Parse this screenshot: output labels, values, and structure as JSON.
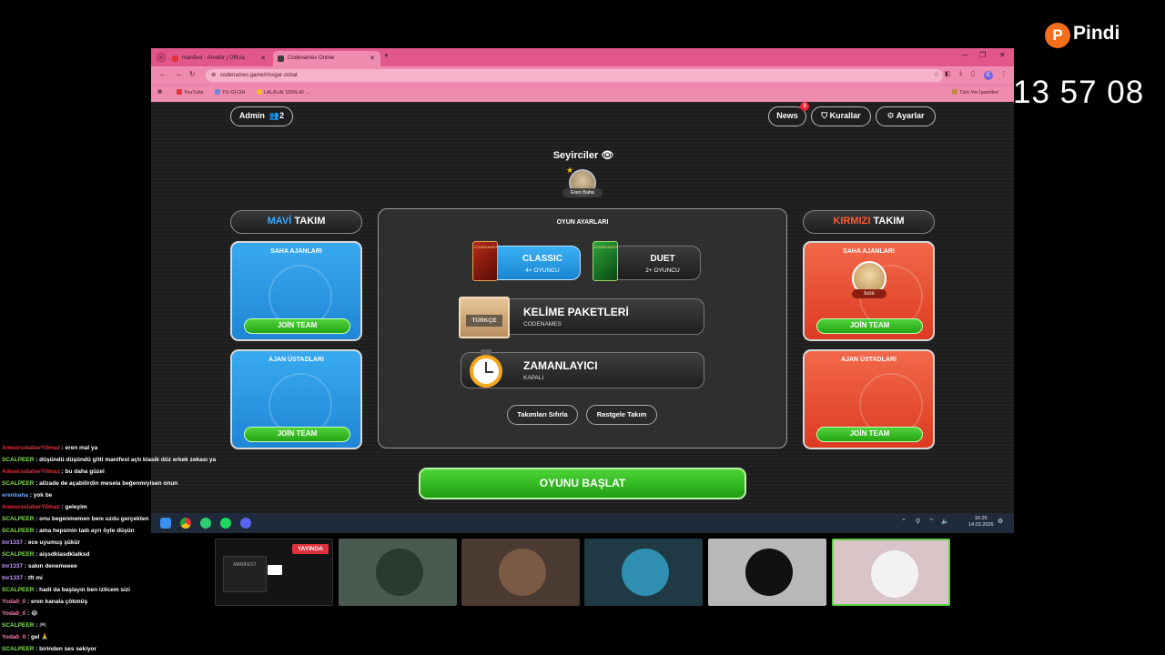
{
  "browser": {
    "tabs": [
      {
        "title": "manifest - Amatör | Officia",
        "active": false
      },
      {
        "title": "Codenames Online",
        "active": true
      }
    ],
    "url": "codenames.game/r/osgar-zebat",
    "bookmarks": [
      "YouTube",
      "YU-Gİ-OH",
      "LALALAI 100% AI ..."
    ],
    "all_bookmarks": "Tüm Yer İşaretleri",
    "profile_initial": "E"
  },
  "header": {
    "admin_label": "Admin",
    "player_count": "2",
    "news_label": "News",
    "news_badge": "3",
    "rules_label": "Kurallar",
    "settings_label": "Ayarlar"
  },
  "spectators": {
    "title": "Seyirciler",
    "player": "Eren Baha"
  },
  "blue_team": {
    "title_colored": "MAVİ",
    "title_rest": " TAKIM",
    "operatives_title": "SAHA AJANLARI",
    "spymasters_title": "AJAN ÜSTADLARI",
    "join_label": "JOİN TEAM"
  },
  "red_team": {
    "title_colored": "KIRMIZI",
    "title_rest": " TAKIM",
    "operatives_title": "SAHA AJANLARI",
    "operative_player": "tuce",
    "spymasters_title": "AJAN ÜSTADLARI",
    "join_label": "JOİN TEAM"
  },
  "game_settings": {
    "title": "OYUN AYARLARI",
    "modes": [
      {
        "name": "CLASSIC",
        "sub": "4+ OYUNCU",
        "box_label": "CODENAMES",
        "selected": true
      },
      {
        "name": "DUET",
        "sub": "2+ OYUNCU",
        "box_label": "CODENAMES",
        "selected": false
      }
    ],
    "word_packs": {
      "title": "KELİME PAKETLERİ",
      "sub": "CODENAMES",
      "crate_label": "TÜRKÇE"
    },
    "timer": {
      "title": "ZAMANLAYICI",
      "sub": "KAPALI"
    },
    "reset_teams": "Takımları Sıfırla",
    "random_teams": "Rastgele Takım"
  },
  "start_button": "OYUNU BAŞLAT",
  "taskbar": {
    "time": "16:26",
    "date": "14.03.2026"
  },
  "overlay": {
    "brand": "Pindi",
    "clock": "13 57 08",
    "live_label": "YAYINDA",
    "mini_screen_label": "MANİFEST"
  },
  "chat": [
    {
      "user": "AmsersidaberYilmaz",
      "text": ": eren mal ya",
      "color": "#e0323c"
    },
    {
      "user": "SCALPEER",
      "text": ": düşündü düşündü gitti manifest açtı klasik düz erkek zekası ya",
      "color": "#7ee04a"
    },
    {
      "user": "AmsersidaberYilmaz",
      "text": ": bu daha güzel",
      "color": "#e0323c"
    },
    {
      "user": "SCALPEER",
      "text": ": alizade de açabilirdin mesela beğenmiyisen onun",
      "color": "#7ee04a"
    },
    {
      "user": "erenbaha",
      "text": ": yok be",
      "color": "#6aa8ff"
    },
    {
      "user": "AmsersidaberYilmaz",
      "text": ": geleyim",
      "color": "#e0323c"
    },
    {
      "user": "SCALPEER",
      "text": ": onu begenmemen benı uzdu gerçekten",
      "color": "#7ee04a"
    },
    {
      "user": "SCALPEER",
      "text": ": ama hepsinin tadı ayrı öyle düşün",
      "color": "#7ee04a"
    },
    {
      "user": "tnr1337",
      "text": ": ece uyumuş şükür",
      "color": "#c79cff"
    },
    {
      "user": "SCALPEER",
      "text": ": aişsdklasdklalksd",
      "color": "#7ee04a"
    },
    {
      "user": "tnr1337",
      "text": ": sakın denemeeee",
      "color": "#c79cff"
    },
    {
      "user": "tnr1337",
      "text": ": tft mi",
      "color": "#c79cff"
    },
    {
      "user": "SCALPEER",
      "text": ": hadi da başlayın ben izlicem sizi",
      "color": "#7ee04a"
    },
    {
      "user": "Yoda0_0",
      "text": ": eren kanala çökmüş",
      "color": "#ff7ab6"
    },
    {
      "user": "Yoda0_0",
      "text": ": 😂",
      "color": "#ff7ab6"
    },
    {
      "user": "SCALPEER",
      "text": ": 🎮",
      "color": "#7ee04a"
    },
    {
      "user": "Yoda0_0",
      "text": ": gel 🙏",
      "color": "#ff7ab6"
    },
    {
      "user": "SCALPEER",
      "text": ": birinden ses sekiyor",
      "color": "#7ee04a"
    }
  ],
  "cams": [
    {
      "bg": "#4a5a50",
      "face": "#2b3a30"
    },
    {
      "bg": "#4a3a32",
      "face": "#7a5a44"
    },
    {
      "bg": "#1f3a44",
      "face": "#2f8fb0"
    },
    {
      "bg": "#b8b8b8",
      "face": "#111111"
    },
    {
      "bg": "#d9c4c8",
      "face": "#f2f2f2"
    }
  ],
  "colors": {
    "accent_green": "#22a511",
    "blue_team": "#1f86d6",
    "red_team": "#dc3b22",
    "browser_pink": "#e2578a"
  }
}
